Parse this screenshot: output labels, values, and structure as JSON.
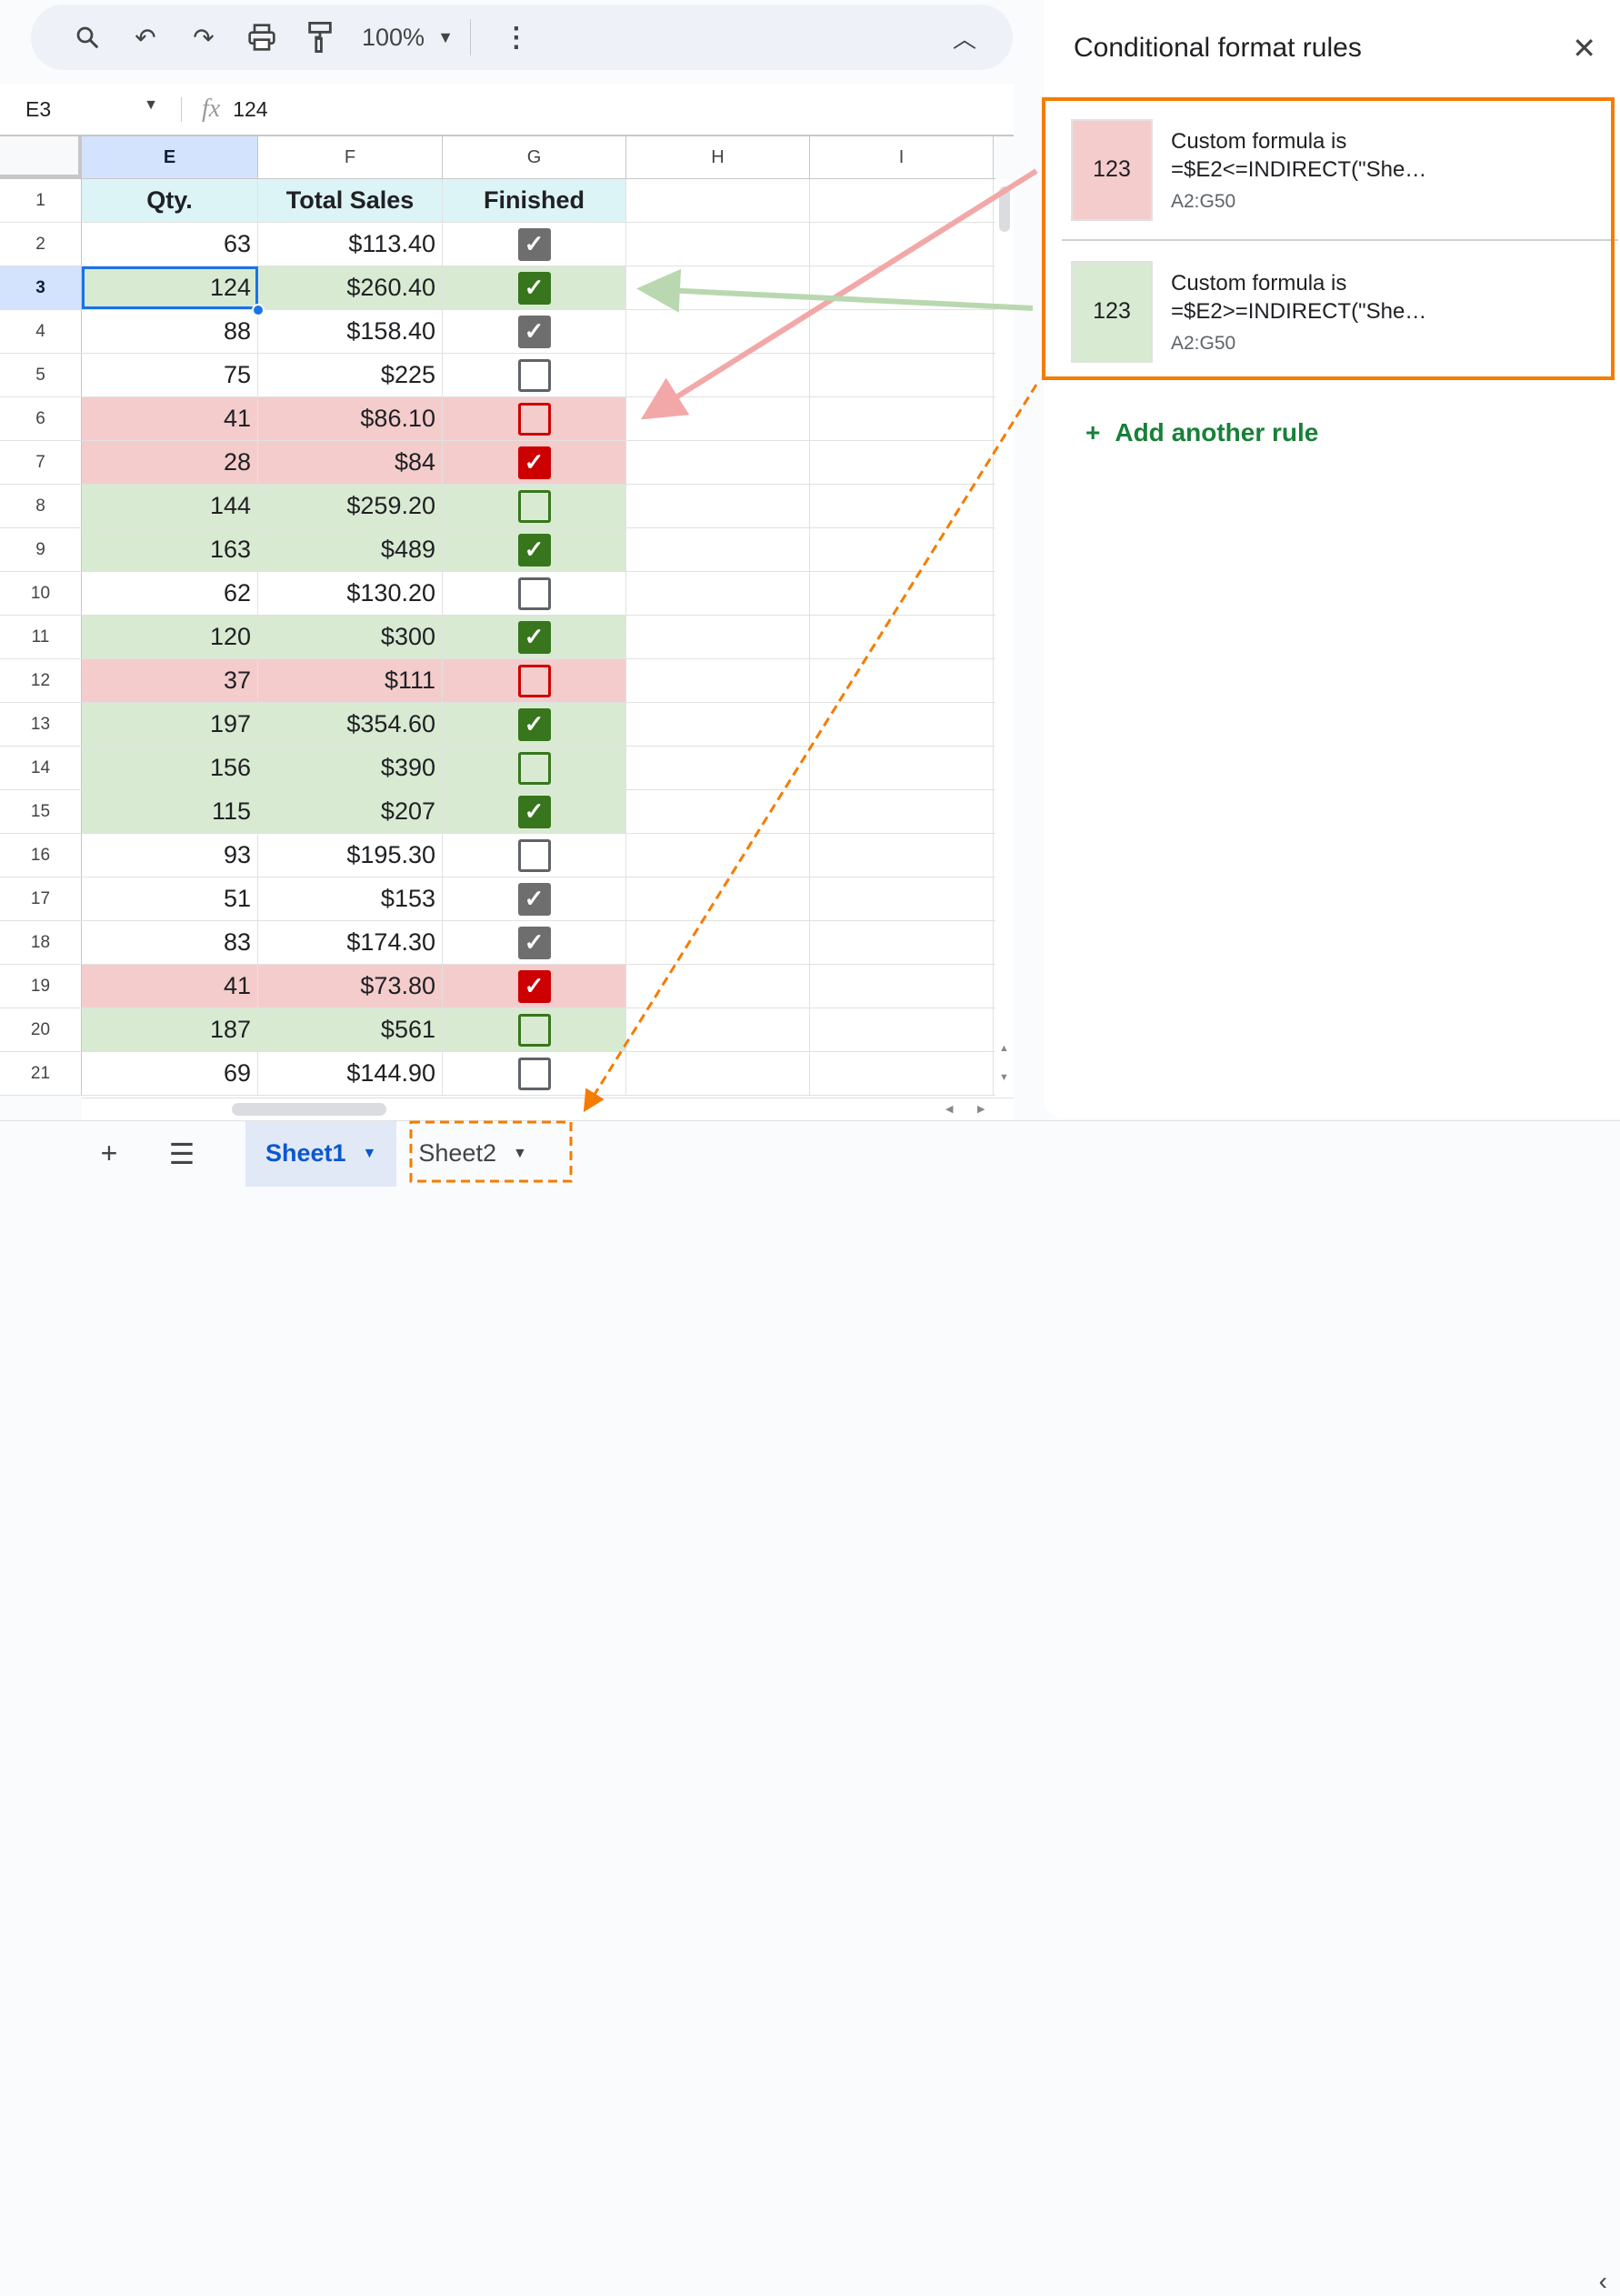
{
  "toolbar": {
    "zoom": "100%"
  },
  "formula_bar": {
    "cell_ref": "E3",
    "value": "124"
  },
  "columns": [
    "E",
    "F",
    "G",
    "H",
    "I"
  ],
  "header_row": {
    "num": "1",
    "qty": "Qty.",
    "total": "Total Sales",
    "finished": "Finished"
  },
  "rows": [
    {
      "num": "2",
      "qty": "63",
      "total": "$113.40",
      "checked": true,
      "fmt": "none"
    },
    {
      "num": "3",
      "qty": "124",
      "total": "$260.40",
      "checked": true,
      "fmt": "green"
    },
    {
      "num": "4",
      "qty": "88",
      "total": "$158.40",
      "checked": true,
      "fmt": "none"
    },
    {
      "num": "5",
      "qty": "75",
      "total": "$225",
      "checked": false,
      "fmt": "none"
    },
    {
      "num": "6",
      "qty": "41",
      "total": "$86.10",
      "checked": false,
      "fmt": "red"
    },
    {
      "num": "7",
      "qty": "28",
      "total": "$84",
      "checked": true,
      "fmt": "red"
    },
    {
      "num": "8",
      "qty": "144",
      "total": "$259.20",
      "checked": false,
      "fmt": "green"
    },
    {
      "num": "9",
      "qty": "163",
      "total": "$489",
      "checked": true,
      "fmt": "green"
    },
    {
      "num": "10",
      "qty": "62",
      "total": "$130.20",
      "checked": false,
      "fmt": "none"
    },
    {
      "num": "11",
      "qty": "120",
      "total": "$300",
      "checked": true,
      "fmt": "green"
    },
    {
      "num": "12",
      "qty": "37",
      "total": "$111",
      "checked": false,
      "fmt": "red"
    },
    {
      "num": "13",
      "qty": "197",
      "total": "$354.60",
      "checked": true,
      "fmt": "green"
    },
    {
      "num": "14",
      "qty": "156",
      "total": "$390",
      "checked": false,
      "fmt": "green"
    },
    {
      "num": "15",
      "qty": "115",
      "total": "$207",
      "checked": true,
      "fmt": "green"
    },
    {
      "num": "16",
      "qty": "93",
      "total": "$195.30",
      "checked": false,
      "fmt": "none"
    },
    {
      "num": "17",
      "qty": "51",
      "total": "$153",
      "checked": true,
      "fmt": "none"
    },
    {
      "num": "18",
      "qty": "83",
      "total": "$174.30",
      "checked": true,
      "fmt": "none"
    },
    {
      "num": "19",
      "qty": "41",
      "total": "$73.80",
      "checked": true,
      "fmt": "red"
    },
    {
      "num": "20",
      "qty": "187",
      "total": "$561",
      "checked": false,
      "fmt": "green"
    },
    {
      "num": "21",
      "qty": "69",
      "total": "$144.90",
      "checked": false,
      "fmt": "none"
    }
  ],
  "active_row": "3",
  "sheets": [
    {
      "label": "Sheet1",
      "active": true
    },
    {
      "label": "Sheet2",
      "active": false
    }
  ],
  "panel": {
    "title": "Conditional format rules",
    "rules": [
      {
        "preview": "123",
        "line1": "Custom formula is",
        "line2": "=$E2<=INDIRECT(\"She…",
        "range": "A2:G50",
        "color": "#f4cccc"
      },
      {
        "preview": "123",
        "line1": "Custom formula is",
        "line2": "=$E2>=INDIRECT(\"She…",
        "range": "A2:G50",
        "color": "#d9ead3"
      }
    ],
    "add_rule": "Add another rule"
  },
  "colors": {
    "highlight_orange": "#f57c00",
    "green_fill": "#d9ead3",
    "red_fill": "#f4cccc",
    "accent": "#1a73e8"
  }
}
